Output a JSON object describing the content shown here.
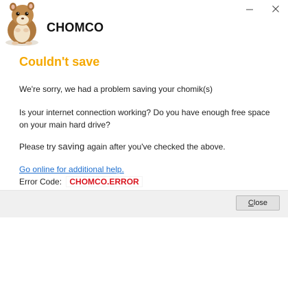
{
  "window": {
    "app_name": "CHOMCO",
    "controls": [
      {
        "name": "minimize",
        "icon": "minimize-icon"
      },
      {
        "name": "close",
        "icon": "close-icon"
      }
    ]
  },
  "dialog": {
    "heading": "Couldn't save",
    "message_1": "We're sorry, we had a problem saving your chomik(s)",
    "message_2": "Is your internet connection working?  Do you have enough free space on your main hard drive?",
    "message_3_before": "Please try ",
    "message_3_emphasis": "saving",
    "message_3_after": " again after you've checked the above.",
    "help_link": "Go online for additional help.",
    "error_label": "Error Code:",
    "error_code": "CHOMCO.ERROR",
    "close_mnemonic": "C",
    "close_rest": "lose"
  },
  "colors": {
    "heading": "#f5a800",
    "link": "#1e6fd0",
    "error_code": "#d8141e"
  },
  "icons": {
    "logo": "hamster-logo"
  }
}
